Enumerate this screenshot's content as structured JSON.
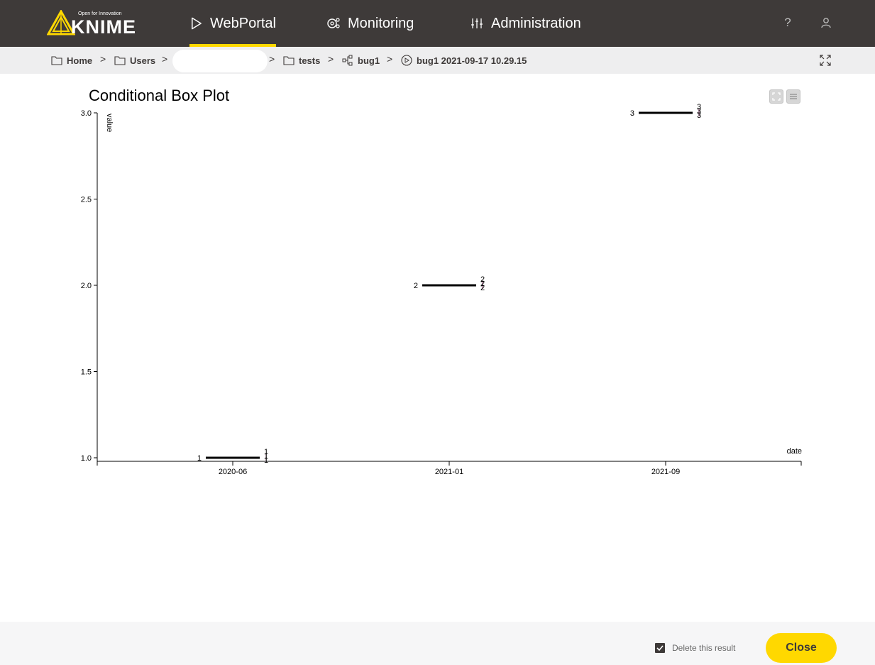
{
  "header": {
    "logo": {
      "tagline": "Open for Innovation",
      "wordmark": "KNIME"
    },
    "nav": {
      "webportal": "WebPortal",
      "monitoring": "Monitoring",
      "administration": "Administration"
    },
    "help_icon_glyph": "?",
    "icons": [
      "play-icon",
      "monitoring-icon",
      "sliders-icon",
      "help-icon",
      "user-icon"
    ],
    "accent_color": "#ffd800",
    "bar_color": "#3e3a39"
  },
  "breadcrumb": {
    "home": "Home",
    "users": "Users",
    "tests": "tests",
    "workflow": "bug1",
    "job": "bug1 2021-09-17 10.29.15",
    "separator": ">"
  },
  "chart_data": {
    "type": "box",
    "title": "Conditional Box Plot",
    "xlabel": "date",
    "ylabel": "value",
    "ylim": [
      1.0,
      3.0
    ],
    "yticks": [
      "1.0",
      "1.5",
      "2.0",
      "2.5",
      "3.0"
    ],
    "xticks": [
      "2020-06",
      "2021-01",
      "2021-09"
    ],
    "boxes": [
      {
        "category": "2020-06",
        "median": 1,
        "label": "1",
        "stat_labels": [
          "1",
          "1",
          "1"
        ]
      },
      {
        "category": "2021-01",
        "median": 2,
        "label": "2",
        "stat_labels": [
          "2",
          "2",
          "2"
        ]
      },
      {
        "category": "2021-09",
        "median": 3,
        "label": "3",
        "stat_labels": [
          "3",
          "3",
          "3"
        ]
      }
    ],
    "grid": false,
    "legend": "none"
  },
  "footer": {
    "delete_label": "Delete this result",
    "delete_checked": true,
    "close_label": "Close"
  }
}
